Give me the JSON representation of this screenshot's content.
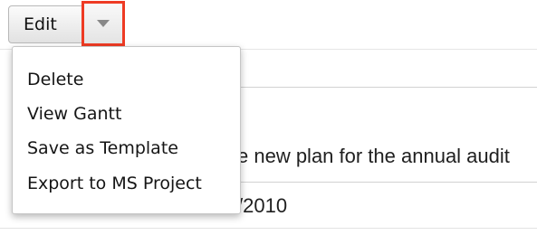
{
  "toolbar": {
    "edit_label": "Edit",
    "caret_icon": "chevron-down-icon",
    "highlight_color": "#ee3b24"
  },
  "dropdown": {
    "items": [
      {
        "label": "Delete"
      },
      {
        "label": "View Gantt"
      },
      {
        "label": "Save as Template"
      },
      {
        "label": "Export to MS Project"
      }
    ]
  },
  "background": {
    "description_fragment": "e new plan for the annual audit",
    "date_fragment": "/2010"
  }
}
